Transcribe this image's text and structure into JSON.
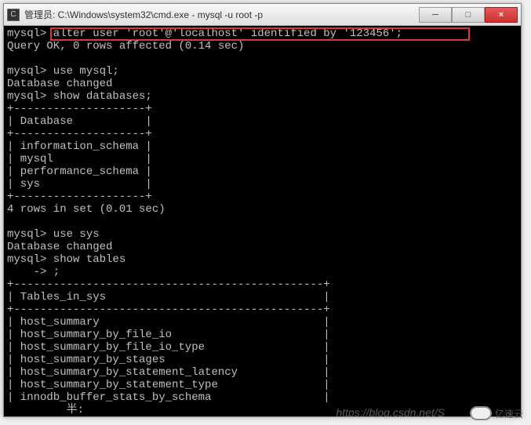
{
  "window": {
    "title": "管理员: C:\\Windows\\system32\\cmd.exe - mysql  -u root -p",
    "icon_char": "C:\\"
  },
  "buttons": {
    "min": "─",
    "max": "□",
    "close": "×"
  },
  "terminal": {
    "lines": [
      "mysql> alter user 'root'@'localhost' identified by '123456';",
      "Query OK, 0 rows affected (0.14 sec)",
      "",
      "mysql> use mysql;",
      "Database changed",
      "mysql> show databases;",
      "+--------------------+",
      "| Database           |",
      "+--------------------+",
      "| information_schema |",
      "| mysql              |",
      "| performance_schema |",
      "| sys                |",
      "+--------------------+",
      "4 rows in set (0.01 sec)",
      "",
      "mysql> use sys",
      "Database changed",
      "mysql> show tables",
      "    -> ;",
      "+-----------------------------------------------+",
      "| Tables_in_sys                                 |",
      "+-----------------------------------------------+",
      "| host_summary                                  |",
      "| host_summary_by_file_io                       |",
      "| host_summary_by_file_io_type                  |",
      "| host_summary_by_stages                        |",
      "| host_summary_by_statement_latency             |",
      "| host_summary_by_statement_type                |",
      "| innodb_buffer_stats_by_schema                 |"
    ],
    "ime_indicator": "         半:"
  },
  "watermark": {
    "url": "https://blog.csdn.net/S",
    "logo_text": "亿速云"
  }
}
